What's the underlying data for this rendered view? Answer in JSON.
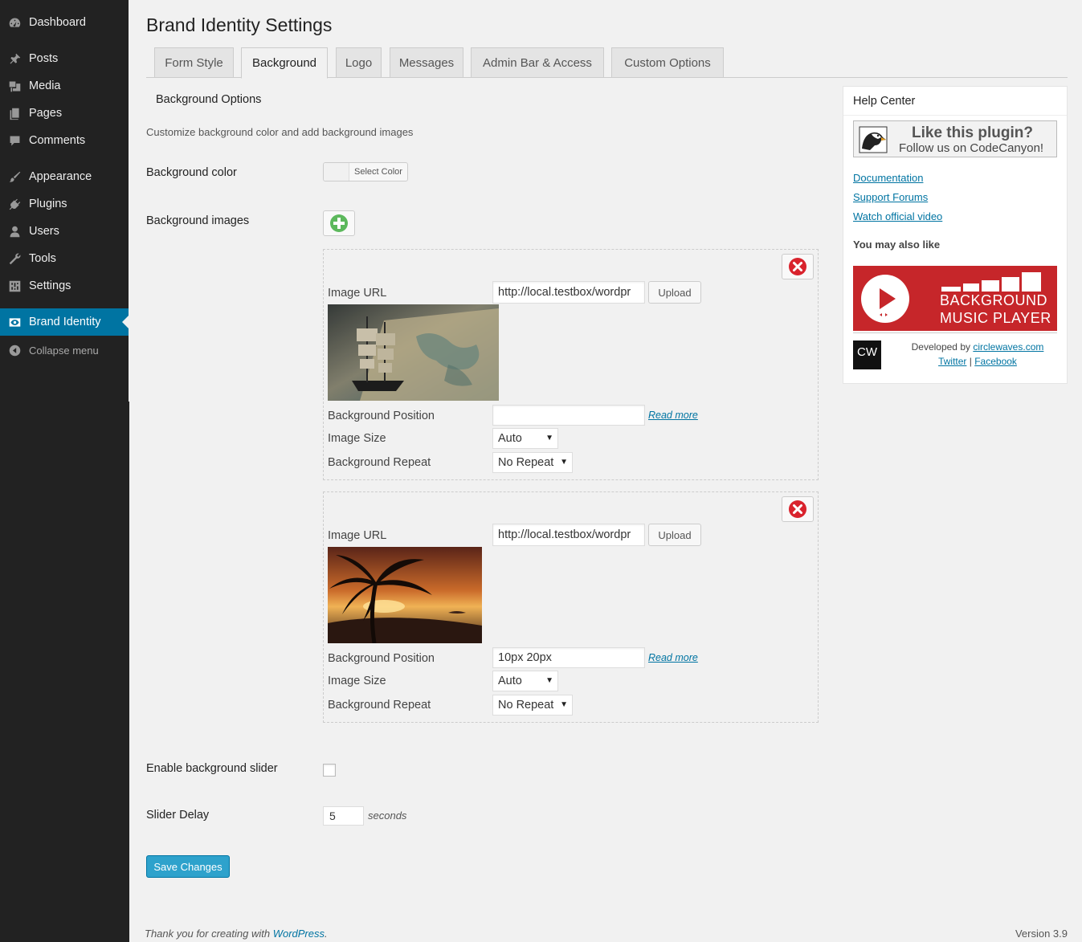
{
  "sidebar": {
    "items": [
      {
        "label": "Dashboard",
        "icon": "dashboard-icon"
      },
      {
        "label": "Posts",
        "icon": "pin-icon"
      },
      {
        "label": "Media",
        "icon": "media-icon"
      },
      {
        "label": "Pages",
        "icon": "pages-icon"
      },
      {
        "label": "Comments",
        "icon": "comment-icon"
      },
      {
        "label": "Appearance",
        "icon": "brush-icon"
      },
      {
        "label": "Plugins",
        "icon": "plug-icon"
      },
      {
        "label": "Users",
        "icon": "user-icon"
      },
      {
        "label": "Tools",
        "icon": "wrench-icon"
      },
      {
        "label": "Settings",
        "icon": "sliders-icon"
      },
      {
        "label": "Brand Identity",
        "icon": "eye-icon"
      }
    ],
    "collapse_label": "Collapse menu"
  },
  "page": {
    "title": "Brand Identity Settings"
  },
  "tabs": [
    "Form Style",
    "Background",
    "Logo",
    "Messages",
    "Admin Bar & Access",
    "Custom Options"
  ],
  "active_tab": "Background",
  "section": {
    "heading": "Background Options",
    "description": "Customize background color and add background images",
    "bg_color_label": "Background color",
    "select_color_label": "Select Color",
    "bg_images_label": "Background images"
  },
  "images": [
    {
      "url_label": "Image URL",
      "url": "http://local.testbox/wordpr",
      "upload_label": "Upload",
      "position_label": "Background Position",
      "position_value": "",
      "read_more": "Read more",
      "size_label": "Image Size",
      "size_value": "Auto",
      "repeat_label": "Background Repeat",
      "repeat_value": "No Repeat"
    },
    {
      "url_label": "Image URL",
      "url": "http://local.testbox/wordpr",
      "upload_label": "Upload",
      "position_label": "Background Position",
      "position_value": "10px 20px",
      "read_more": "Read more",
      "size_label": "Image Size",
      "size_value": "Auto",
      "repeat_label": "Background Repeat",
      "repeat_value": "No Repeat"
    }
  ],
  "slider": {
    "enable_label": "Enable background slider",
    "enabled": false,
    "delay_label": "Slider Delay",
    "delay_value": "5",
    "delay_unit": "seconds"
  },
  "save_label": "Save Changes",
  "help": {
    "title": "Help Center",
    "banner_line1": "Like this plugin?",
    "banner_line2": "Follow us on CodeCanyon!",
    "links": [
      "Documentation",
      "Support Forums",
      "Watch official video"
    ],
    "also_like": "You may also like",
    "promo_line1": "BACKGROUND",
    "promo_line2": "MUSIC PLAYER",
    "cw_logo": "CW",
    "developed_by": "Developed by",
    "dev_site": "circlewaves.com",
    "twitter": "Twitter",
    "separator": "|",
    "facebook": "Facebook"
  },
  "footer": {
    "thanks_prefix": "Thank you for creating with",
    "wordpress": "WordPress",
    "thanks_suffix": ".",
    "version": "Version 3.9"
  },
  "colors": {
    "sidebar_bg": "#222222",
    "active_menu": "#0074a2",
    "primary_button": "#2ea2cc",
    "link": "#0074a2",
    "add_icon": "#5cb85c",
    "remove_icon": "#d9232d",
    "promo_bg": "#c6262a"
  }
}
